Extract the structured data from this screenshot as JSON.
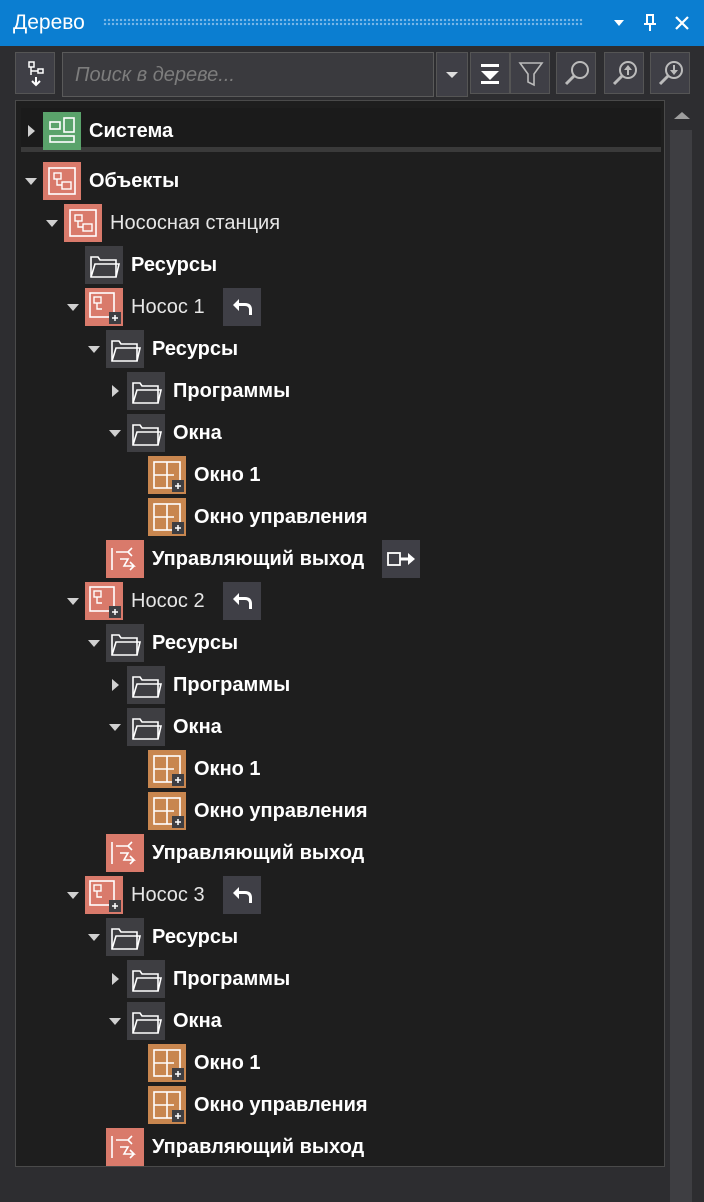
{
  "window": {
    "title": "Дерево",
    "menu_icon": "chevron-down-icon",
    "pin_icon": "pin-icon",
    "close_icon": "close-icon"
  },
  "toolbar": {
    "search_placeholder": "Поиск в дереве...",
    "buttons": [
      "tree-structure-icon",
      "collapse-all-icon",
      "filter-icon",
      "search-icon",
      "find-previous-icon",
      "find-next-icon"
    ]
  },
  "colors": {
    "accent": "#0b7ed1",
    "object_icon": "#d97a6b",
    "window_icon": "#c8864f",
    "system_icon": "#5aa36b",
    "folder_icon": "#3e3e42"
  },
  "tree": [
    {
      "label": "Система",
      "level": 0,
      "state": "closed",
      "icon": "system-icon"
    },
    {
      "label": "Объекты",
      "level": 0,
      "state": "open",
      "icon": "object-icon"
    },
    {
      "label": "Нососная станция",
      "level": 1,
      "state": "open",
      "icon": "object-icon"
    },
    {
      "label": "Ресурсы",
      "level": 2,
      "state": "none",
      "icon": "folder-icon"
    },
    {
      "label": "Носос 1",
      "level": 2,
      "state": "open",
      "icon": "object-lock-icon",
      "badge": "undo-icon"
    },
    {
      "label": "Ресурсы",
      "level": 3,
      "state": "open",
      "icon": "folder-icon"
    },
    {
      "label": "Программы",
      "level": 4,
      "state": "closed",
      "icon": "folder-icon"
    },
    {
      "label": "Окна",
      "level": 4,
      "state": "open",
      "icon": "folder-icon"
    },
    {
      "label": "Окно 1",
      "level": 5,
      "state": "none",
      "icon": "window-icon"
    },
    {
      "label": "Окно управления",
      "level": 5,
      "state": "none",
      "icon": "window-icon"
    },
    {
      "label": "Управляющий выход",
      "level": 3,
      "state": "none",
      "icon": "output-icon",
      "badge": "export-icon"
    },
    {
      "label": "Носос 2",
      "level": 2,
      "state": "open",
      "icon": "object-lock-icon",
      "badge": "undo-icon"
    },
    {
      "label": "Ресурсы",
      "level": 3,
      "state": "open",
      "icon": "folder-icon"
    },
    {
      "label": "Программы",
      "level": 4,
      "state": "closed",
      "icon": "folder-icon"
    },
    {
      "label": "Окна",
      "level": 4,
      "state": "open",
      "icon": "folder-icon"
    },
    {
      "label": "Окно 1",
      "level": 5,
      "state": "none",
      "icon": "window-icon"
    },
    {
      "label": "Окно управления",
      "level": 5,
      "state": "none",
      "icon": "window-icon"
    },
    {
      "label": "Управляющий выход",
      "level": 3,
      "state": "none",
      "icon": "output-icon"
    },
    {
      "label": "Носос 3",
      "level": 2,
      "state": "open",
      "icon": "object-lock-icon",
      "badge": "undo-icon"
    },
    {
      "label": "Ресурсы",
      "level": 3,
      "state": "open",
      "icon": "folder-icon"
    },
    {
      "label": "Программы",
      "level": 4,
      "state": "closed",
      "icon": "folder-icon"
    },
    {
      "label": "Окна",
      "level": 4,
      "state": "open",
      "icon": "folder-icon"
    },
    {
      "label": "Окно 1",
      "level": 5,
      "state": "none",
      "icon": "window-icon"
    },
    {
      "label": "Окно управления",
      "level": 5,
      "state": "none",
      "icon": "window-icon"
    },
    {
      "label": "Управляющий выход",
      "level": 3,
      "state": "none",
      "icon": "output-icon"
    }
  ]
}
